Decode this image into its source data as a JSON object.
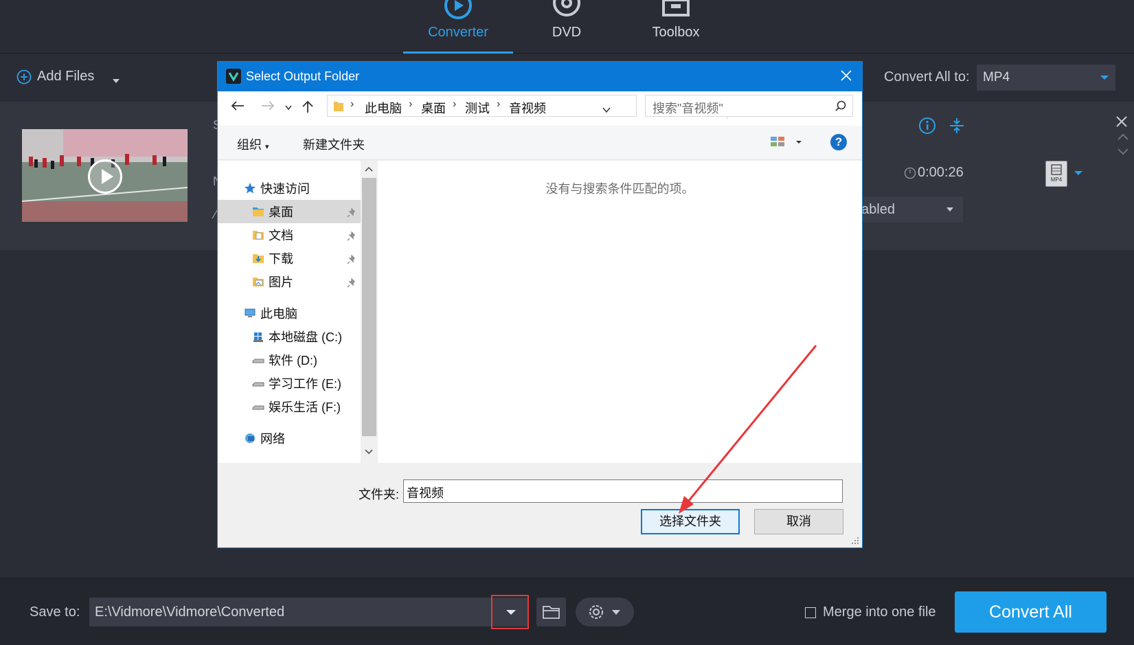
{
  "topnav": {
    "tabs": [
      {
        "label": "Converter",
        "active": true
      },
      {
        "label": "DVD",
        "active": false
      },
      {
        "label": "Toolbox",
        "active": false
      }
    ]
  },
  "toolbar": {
    "add_files": "Add Files",
    "convert_all_to_label": "Convert All to:",
    "format": "MP4"
  },
  "file_row": {
    "duration": "0:00:26",
    "subtitle_value": "abled",
    "format_badge": "MP4"
  },
  "dialog": {
    "title": "Select Output Folder",
    "breadcrumb": [
      "此电脑",
      "桌面",
      "测试",
      "音视频"
    ],
    "search_placeholder": "搜索\"音视频\"",
    "organize": "组织",
    "new_folder": "新建文件夹",
    "help": "?",
    "nav": {
      "quick_access": "快速访问",
      "quick_items": [
        "桌面",
        "文档",
        "下载",
        "图片"
      ],
      "this_pc": "此电脑",
      "drives": [
        "本地磁盘 (C:)",
        "软件 (D:)",
        "学习工作 (E:)",
        "娱乐生活 (F:)"
      ],
      "network": "网络"
    },
    "empty_message": "没有与搜索条件匹配的项。",
    "folder_label": "文件夹:",
    "folder_value": "音视频",
    "select_button": "选择文件夹",
    "cancel_button": "取消"
  },
  "bottom": {
    "save_to_label": "Save to:",
    "save_path": "E:\\Vidmore\\Vidmore\\Converted",
    "merge_label": "Merge into one file",
    "merge_checked": false,
    "convert_all": "Convert All"
  },
  "colors": {
    "accent": "#2d9fe6",
    "dialog_titlebar": "#0a78d7",
    "highlight_box": "#e23b3b",
    "arrow": "#e8373a"
  }
}
